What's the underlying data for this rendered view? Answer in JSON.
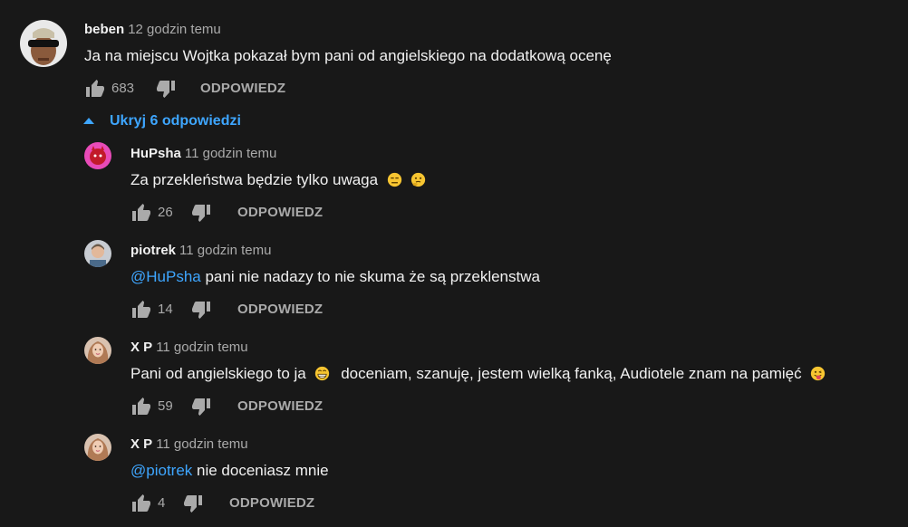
{
  "top_comment": {
    "author": "beben",
    "time": "12 godzin temu",
    "text": "Ja na miejscu Wojtka pokazał bym pani od angielskiego na dodatkową ocenę",
    "likes": "683",
    "reply_label": "ODPOWIEDZ"
  },
  "replies_toggle": {
    "label": "Ukryj 6 odpowiedzi"
  },
  "replies": [
    {
      "author": "HuPsha",
      "time": "11 godzin temu",
      "text": "Za przekleństwa będzie tylko uwaga",
      "emojis": [
        "expressionless-face",
        "thinking-face"
      ],
      "likes": "26",
      "reply_label": "ODPOWIEDZ"
    },
    {
      "author": "piotrek",
      "time": "11 godzin temu",
      "mention": "@HuPsha",
      "text": " pani nie nadazy to nie skuma że są przeklenstwa",
      "likes": "14",
      "reply_label": "ODPOWIEDZ"
    },
    {
      "author": "X P",
      "time": "11 godzin temu",
      "text_before": "Pani od angielskiego to ja",
      "text_after": "doceniam, szanuję, jestem wielką fanką, Audiotele znam na pamięć",
      "emojis": [
        "grinning-face",
        "tongue-face"
      ],
      "likes": "59",
      "reply_label": "ODPOWIEDZ"
    },
    {
      "author": "X P",
      "time": "11 godzin temu",
      "mention": "@piotrek",
      "text": " nie doceniasz mnie",
      "likes": "4",
      "reply_label": "ODPOWIEDZ"
    }
  ],
  "colors": {
    "background": "#181818",
    "text": "#f1f1f1",
    "secondary": "#aaaaaa",
    "link": "#3ea6ff"
  }
}
